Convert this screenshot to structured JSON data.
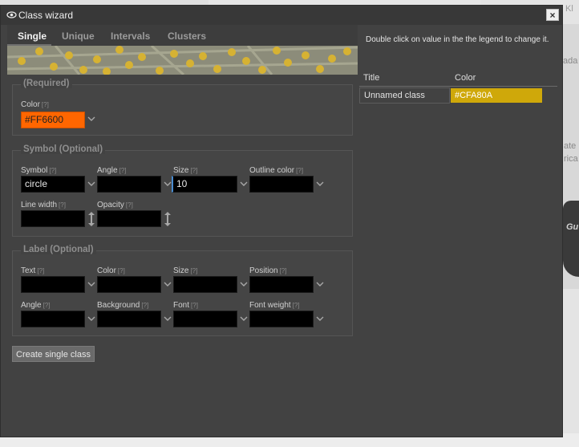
{
  "background": {
    "map_texts": [
      "Kl",
      "ada",
      "ate",
      "rica",
      "Gu"
    ]
  },
  "dialog": {
    "title": "Class wizard",
    "close_label": "×"
  },
  "tabs": [
    {
      "label": "Single",
      "active": true
    },
    {
      "label": "Unique",
      "active": false
    },
    {
      "label": "Intervals",
      "active": false
    },
    {
      "label": "Clusters",
      "active": false
    }
  ],
  "required": {
    "legend": "(Required)",
    "color_label": "Color",
    "color_value": "#FF6600",
    "help": "[?]"
  },
  "symbol": {
    "legend": "Symbol (Optional)",
    "symbol_label": "Symbol",
    "symbol_value": "circle",
    "angle_label": "Angle",
    "angle_value": "",
    "size_label": "Size",
    "size_value": "10",
    "outline_label": "Outline color",
    "outline_value": "",
    "linewidth_label": "Line width",
    "linewidth_value": "",
    "opacity_label": "Opacity",
    "opacity_value": ""
  },
  "label": {
    "legend": "Label (Optional)",
    "text_label": "Text",
    "color_label": "Color",
    "size_label": "Size",
    "position_label": "Position",
    "angle_label": "Angle",
    "background_label": "Background",
    "font_label": "Font",
    "fontweight_label": "Font weight"
  },
  "create_button": "Create single class",
  "legend_panel": {
    "hint": "Double click on value in the the legend to change it.",
    "col_title": "Title",
    "col_color": "Color",
    "rows": [
      {
        "title": "Unnamed class",
        "color": "#CFA80A"
      }
    ]
  },
  "colors": {
    "accent_orange": "#FF6600",
    "class_color": "#CFA80A"
  }
}
